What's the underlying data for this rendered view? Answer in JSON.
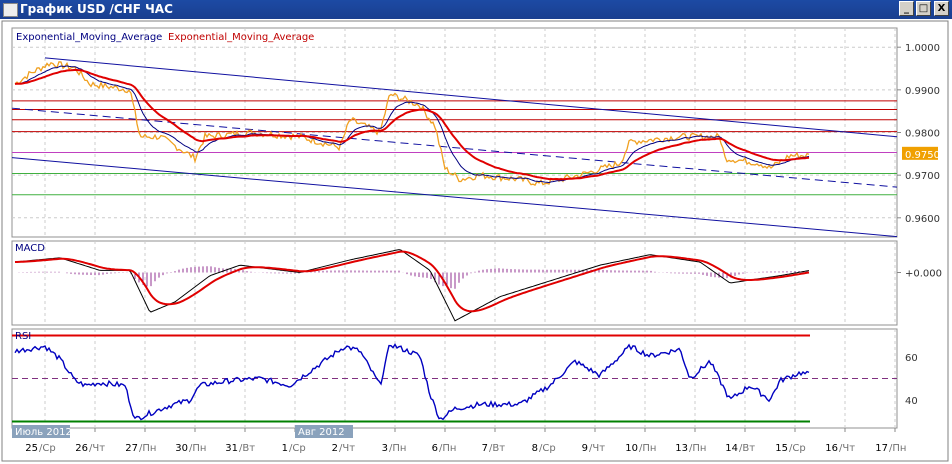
{
  "window": {
    "title": "График USD /CHF  ЧАС",
    "minimize": "_",
    "maximize": "□",
    "close": "X"
  },
  "chart_data": {
    "type": "line",
    "symbol": "USD/CHF",
    "timeframe": "ЧАС",
    "legend": [
      {
        "label": "Exponential_Moving_Average",
        "color": "#000080"
      },
      {
        "label": "Exponential_Moving_Average",
        "color": "#c00000"
      }
    ],
    "price_axis": {
      "ticks": [
        "1.0000",
        "0.9900",
        "0.9800",
        "0.9700",
        "0.9600"
      ],
      "tick_values": [
        1.0,
        0.99,
        0.98,
        0.97,
        0.96
      ],
      "ylim": [
        0.9555,
        1.0045
      ],
      "last_price": "0.9750"
    },
    "price": [
      [
        -0.6,
        0.9914
      ],
      [
        -0.3,
        0.9938
      ],
      [
        0.1,
        0.9963
      ],
      [
        0.6,
        0.9951
      ],
      [
        0.9,
        0.9914
      ],
      [
        1.7,
        0.99
      ],
      [
        1.9,
        0.979
      ],
      [
        2.3,
        0.979
      ],
      [
        3.0,
        0.974
      ],
      [
        3.2,
        0.979
      ],
      [
        4.1,
        0.98
      ],
      [
        5.1,
        0.979
      ],
      [
        5.9,
        0.9765
      ],
      [
        6.1,
        0.983
      ],
      [
        6.7,
        0.98
      ],
      [
        6.9,
        0.989
      ],
      [
        7.5,
        0.9864
      ],
      [
        7.8,
        0.9815
      ],
      [
        8.0,
        0.9716
      ],
      [
        8.3,
        0.969
      ],
      [
        8.7,
        0.97
      ],
      [
        9.5,
        0.969
      ],
      [
        9.9,
        0.968
      ],
      [
        10.7,
        0.97
      ],
      [
        11.5,
        0.9728
      ],
      [
        11.7,
        0.9778
      ],
      [
        12.7,
        0.979
      ],
      [
        13.5,
        0.979
      ],
      [
        13.6,
        0.974
      ],
      [
        14.3,
        0.9728
      ],
      [
        14.5,
        0.9716
      ],
      [
        14.9,
        0.9746
      ],
      [
        15.3,
        0.9746
      ]
    ],
    "horizontal_levels": [
      {
        "value": 0.9874,
        "color": "#c00000"
      },
      {
        "value": 0.9854,
        "color": "#c00000"
      },
      {
        "value": 0.983,
        "color": "#c00000"
      },
      {
        "value": 0.9802,
        "color": "#c00000"
      },
      {
        "value": 0.9753,
        "color": "#c040c0"
      },
      {
        "value": 0.9704,
        "color": "#40b040"
      },
      {
        "value": 0.9654,
        "color": "#40b040"
      }
    ],
    "trend_channel": [
      {
        "from": [
          0,
          0.9975
        ],
        "to": [
          17,
          0.979
        ],
        "style": "solid"
      },
      {
        "from": [
          -0.66,
          0.9857
        ],
        "to": [
          17,
          0.9672
        ],
        "style": "dashed"
      },
      {
        "from": [
          -0.66,
          0.9741
        ],
        "to": [
          17,
          0.9556
        ],
        "style": "solid"
      }
    ],
    "macd": {
      "label": "MACD",
      "zero_label": "+0.000",
      "ylim": [
        -25,
        15
      ],
      "values": [
        [
          -0.6,
          5
        ],
        [
          0.3,
          7
        ],
        [
          1.1,
          1
        ],
        [
          1.7,
          1
        ],
        [
          2.1,
          -19
        ],
        [
          2.6,
          -14
        ],
        [
          3.3,
          -1.5
        ],
        [
          3.9,
          3.5
        ],
        [
          5.1,
          0
        ],
        [
          6.1,
          6
        ],
        [
          7.1,
          11
        ],
        [
          7.7,
          1
        ],
        [
          8.2,
          -23
        ],
        [
          9.1,
          -11.5
        ],
        [
          10.1,
          -4
        ],
        [
          11.1,
          3.5
        ],
        [
          12.1,
          8.5
        ],
        [
          13.1,
          5
        ],
        [
          13.7,
          -5
        ],
        [
          14.7,
          -1.5
        ],
        [
          15.3,
          1
        ]
      ]
    },
    "rsi": {
      "label": "RSI",
      "ticks": [
        "60",
        "40"
      ],
      "tick_values": [
        60,
        40
      ],
      "levels": [
        70,
        50,
        30
      ],
      "ylim": [
        27,
        73
      ],
      "values": [
        [
          -0.6,
          62.7
        ],
        [
          0,
          65
        ],
        [
          0.3,
          59
        ],
        [
          0.6,
          49
        ],
        [
          0.8,
          46.8
        ],
        [
          1.1,
          48
        ],
        [
          1.6,
          46.8
        ],
        [
          1.8,
          31
        ],
        [
          2,
          33
        ],
        [
          2.5,
          37.5
        ],
        [
          2.9,
          40
        ],
        [
          3.1,
          46.8
        ],
        [
          3.7,
          49
        ],
        [
          4.3,
          50
        ],
        [
          4.9,
          46.8
        ],
        [
          6,
          65
        ],
        [
          6.3,
          62.7
        ],
        [
          6.7,
          46.8
        ],
        [
          6.9,
          66
        ],
        [
          7.5,
          60.5
        ],
        [
          7.7,
          42.7
        ],
        [
          7.9,
          31
        ],
        [
          8.2,
          36
        ],
        [
          8.7,
          38
        ],
        [
          9.5,
          38
        ],
        [
          10.1,
          46.8
        ],
        [
          10.6,
          58
        ],
        [
          11.1,
          51.4
        ],
        [
          11.7,
          65
        ],
        [
          12.1,
          60.5
        ],
        [
          12.7,
          63.6
        ],
        [
          12.9,
          50
        ],
        [
          13.3,
          58
        ],
        [
          13.7,
          40
        ],
        [
          14.1,
          46.8
        ],
        [
          14.5,
          40
        ],
        [
          14.7,
          49
        ],
        [
          15.1,
          52.7
        ],
        [
          15.3,
          51.8
        ]
      ]
    },
    "month_labels": [
      {
        "label": "Июль 2012",
        "day": -0.66
      },
      {
        "label": "Авг 2012",
        "day": 5
      }
    ],
    "x_ticks": [
      {
        "d": "25",
        "w": "Ср"
      },
      {
        "d": "26",
        "w": "Чт"
      },
      {
        "d": "27",
        "w": "Пн"
      },
      {
        "d": "30",
        "w": "Пн"
      },
      {
        "d": "31",
        "w": "Вт"
      },
      {
        "d": "1",
        "w": "Ср"
      },
      {
        "d": "2",
        "w": "Чт"
      },
      {
        "d": "3",
        "w": "Пн"
      },
      {
        "d": "6",
        "w": "Пн"
      },
      {
        "d": "7",
        "w": "Вт"
      },
      {
        "d": "8",
        "w": "Ср"
      },
      {
        "d": "9",
        "w": "Чт"
      },
      {
        "d": "10",
        "w": "Пн"
      },
      {
        "d": "13",
        "w": "Пн"
      },
      {
        "d": "14",
        "w": "Вт"
      },
      {
        "d": "15",
        "w": "Ср"
      },
      {
        "d": "16",
        "w": "Чт"
      },
      {
        "d": "17",
        "w": "Пн"
      }
    ],
    "colors": {
      "price": "#f0a020",
      "ema_fast": "#000080",
      "ema_slow": "#e00000",
      "rsi": "#0000c0",
      "axis_label": "#707070",
      "last_price_bg": "#f0a000"
    }
  }
}
